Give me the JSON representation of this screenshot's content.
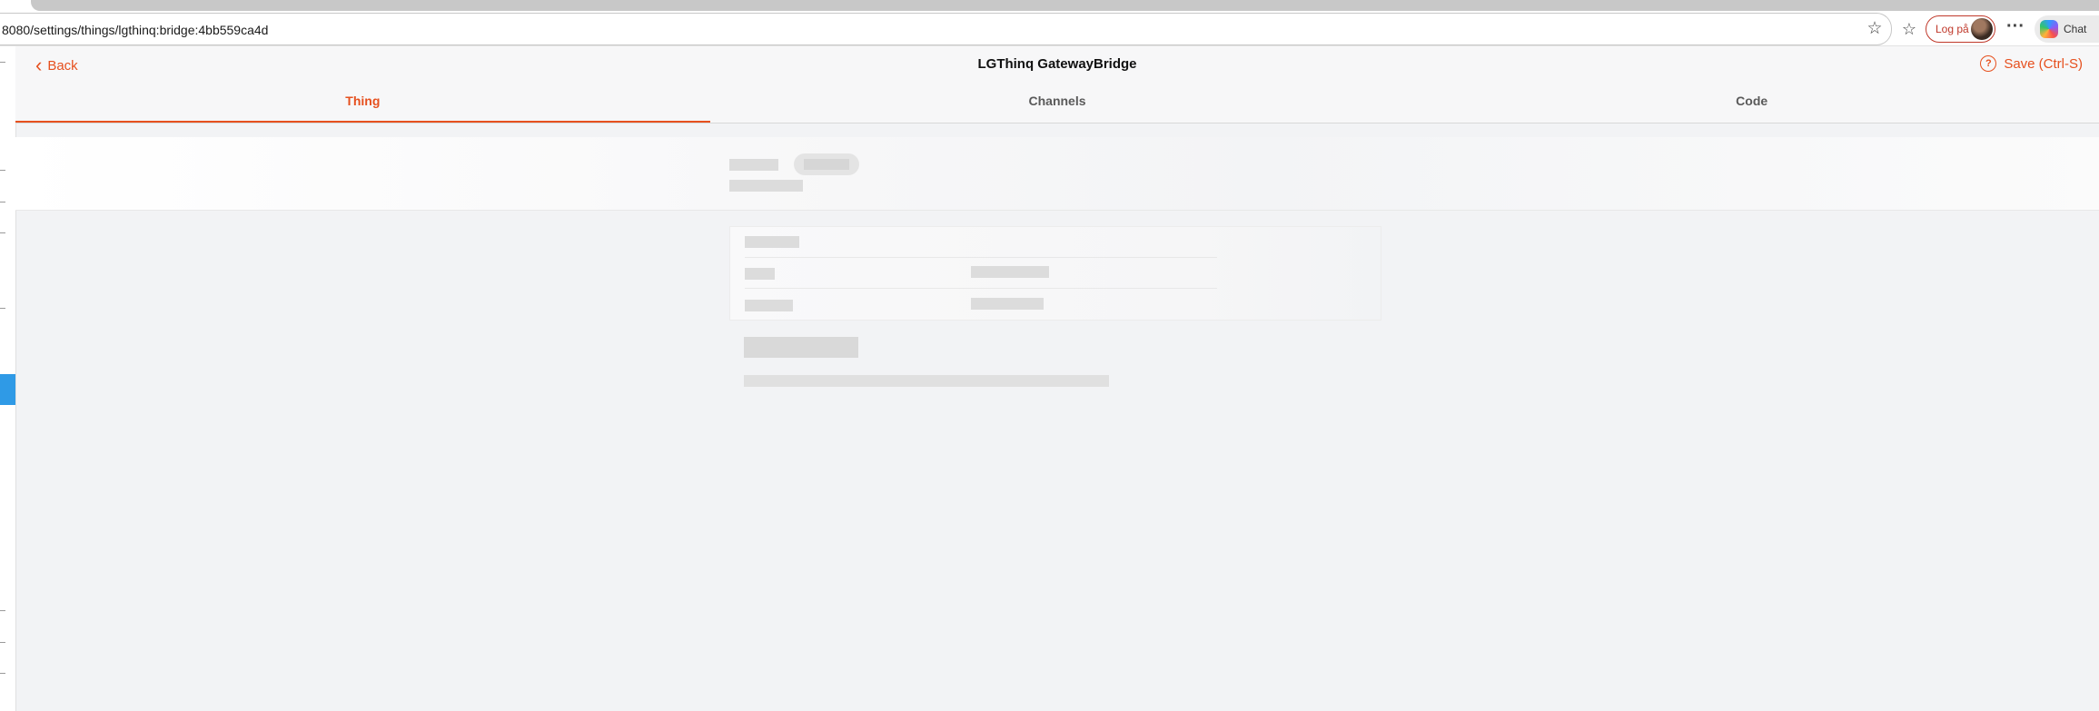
{
  "browser": {
    "url": "8080/settings/things/lgthinq:bridge:4bb559ca4d",
    "login_label": "Log på",
    "chat_label": "Chat"
  },
  "header": {
    "back_label": "Back",
    "title": "LGThinq GatewayBridge",
    "save_label": "Save (Ctrl-S)"
  },
  "tabs": [
    {
      "label": "Thing",
      "active": true
    },
    {
      "label": "Channels",
      "active": false
    },
    {
      "label": "Code",
      "active": false
    }
  ],
  "colors": {
    "accent": "#e6501e",
    "sidebar_active": "#2f9ae6",
    "background": "#f2f3f5"
  },
  "icons": [
    "star-icon",
    "favorites-icon",
    "avatar",
    "more-icon",
    "copilot-icon",
    "chevron-left-icon",
    "help-icon"
  ]
}
